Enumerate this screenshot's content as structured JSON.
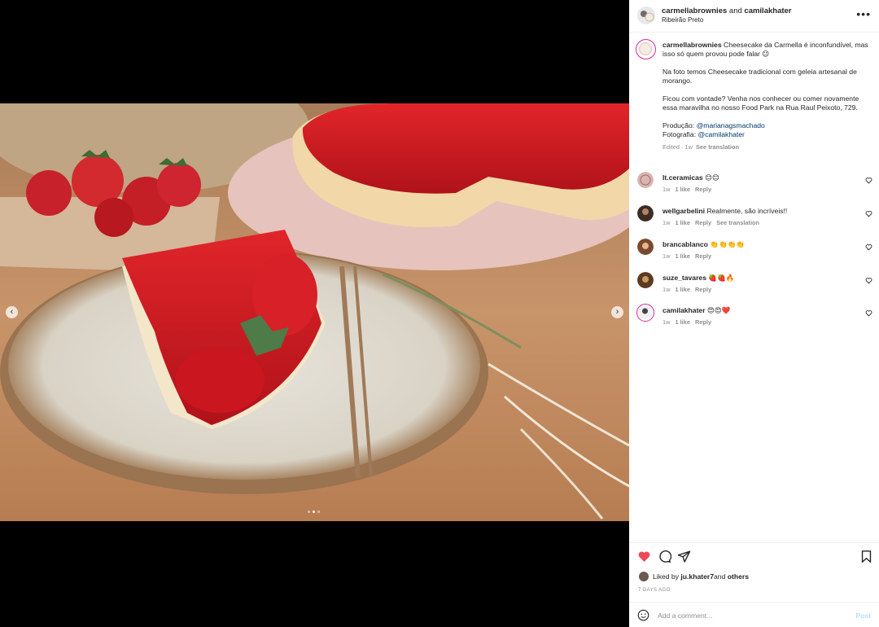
{
  "post": {
    "user1": "carmellabrownies",
    "and_text": " and ",
    "user2": "camilakhater",
    "location": "Ribeirão Preto"
  },
  "caption": {
    "user": "carmellabrownies",
    "line1": " Cheesecake da Carmella é inconfundível, mas isso só quem provou pode falar 😉",
    "para2": "Na foto temos Cheesecake tradicional com geleia artesanal de morango.",
    "para3": "Ficou com vontade? Venha nos conhecer ou comer novamente essa maravilha no nosso Food Park na Rua Raul Peixoto, 729.",
    "credit1_label": "Produção: ",
    "credit1_mention": "@marianagsmachado",
    "credit2_label": "Fotografia: ",
    "credit2_mention": "@camilakhater",
    "meta_time": "Edited · 1w",
    "meta_translate": "See translation"
  },
  "comments": [
    {
      "user": "lt.ceramicas",
      "text": " 😊😊",
      "time": "1w",
      "likes": "1 like",
      "reply": "Reply",
      "translate": ""
    },
    {
      "user": "wellgarbelini",
      "text": " Realmente, são incríveis!!",
      "time": "1w",
      "likes": "1 like",
      "reply": "Reply",
      "translate": "See translation"
    },
    {
      "user": "brancablanco",
      "text": " 👏👏👏👏",
      "time": "1w",
      "likes": "1 like",
      "reply": "Reply",
      "translate": ""
    },
    {
      "user": "suze_tavares",
      "text": " 🍓🍓🔥",
      "time": "1w",
      "likes": "1 like",
      "reply": "Reply",
      "translate": ""
    },
    {
      "user": "camilakhater",
      "text": " 😍😍❤️",
      "time": "1w",
      "likes": "1 like",
      "reply": "Reply",
      "translate": ""
    }
  ],
  "actions": {
    "liked_prefix": "Liked by ",
    "liked_user": "ju.khater7",
    "liked_mid": " and ",
    "liked_others": "others",
    "ago": "7 DAYS AGO",
    "comment_placeholder": "Add a comment...",
    "post_label": "Post"
  },
  "colors": {
    "heart_filled": "#ed4956",
    "mention": "#00376b",
    "post_disabled": "#b2dffc"
  },
  "carousel": {
    "total_slides": 3,
    "active_slide": 2
  }
}
